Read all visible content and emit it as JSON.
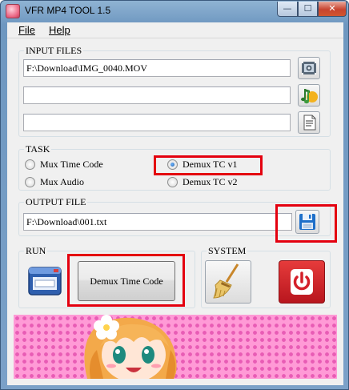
{
  "window": {
    "title": "VFR MP4 TOOL 1.5",
    "min_glyph": "—",
    "max_glyph": "☐",
    "close_glyph": "✕"
  },
  "menu": {
    "file": "File",
    "help": "Help"
  },
  "input_files": {
    "label": "INPUT FILES",
    "fields": [
      {
        "value": "F:\\Download\\IMG_0040.MOV",
        "icon": "video-file-icon"
      },
      {
        "value": "",
        "icon": "audio-file-icon"
      },
      {
        "value": "",
        "icon": "text-file-icon"
      }
    ]
  },
  "task": {
    "label": "TASK",
    "options": [
      {
        "label": "Mux Time Code",
        "checked": false
      },
      {
        "label": "Demux TC v1",
        "checked": true
      },
      {
        "label": "Mux Audio",
        "checked": false
      },
      {
        "label": "Demux TC v2",
        "checked": false
      }
    ]
  },
  "output_file": {
    "label": "OUTPUT FILE",
    "value": "F:\\Download\\001.txt",
    "icon": "save-floppy-icon"
  },
  "run": {
    "label": "RUN",
    "button_label": "Demux Time Code",
    "icon": "window-app-icon"
  },
  "system": {
    "label": "SYSTEM",
    "clean_icon": "broom-icon",
    "power_icon": "power-icon"
  },
  "colors": {
    "highlight": "#e4000f",
    "banner_pink": "#ff9ad6",
    "power_red": "#d4202a",
    "floppy_blue": "#1e6fc9"
  }
}
